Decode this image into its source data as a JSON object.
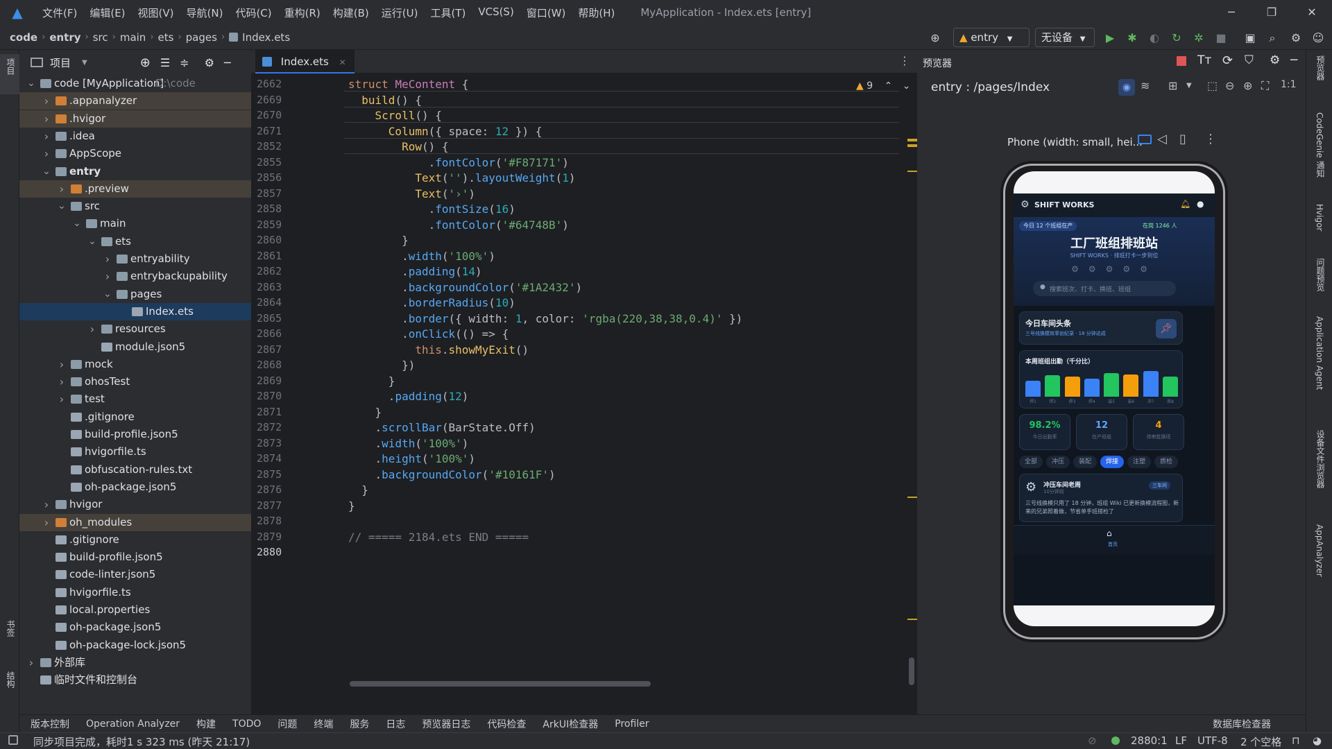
{
  "window": {
    "title": "MyApplication - Index.ets [entry]"
  },
  "menu": [
    "文件(F)",
    "编辑(E)",
    "视图(V)",
    "导航(N)",
    "代码(C)",
    "重构(R)",
    "构建(B)",
    "运行(U)",
    "工具(T)",
    "VCS(S)",
    "窗口(W)",
    "帮助(H)"
  ],
  "breadcrumb": [
    "code",
    "entry",
    "src",
    "main",
    "ets",
    "pages",
    "Index.ets"
  ],
  "run_toolbar": {
    "module": "entry",
    "device": "无设备"
  },
  "left_strip": {
    "project": "项目",
    "bookmarks": "书签",
    "structure": "结构"
  },
  "project_panel": {
    "title": "项目",
    "tree": [
      {
        "depth": 0,
        "arrow": "down",
        "label": "code [MyApplication]",
        "hint": "D:\\code",
        "icon": "module"
      },
      {
        "depth": 1,
        "arrow": "right",
        "label": ".appanalyzer",
        "icon": "folder-orange",
        "hl": true
      },
      {
        "depth": 1,
        "arrow": "right",
        "label": ".hvigor",
        "icon": "folder-orange",
        "hl": true
      },
      {
        "depth": 1,
        "arrow": "right",
        "label": ".idea",
        "icon": "folder"
      },
      {
        "depth": 1,
        "arrow": "right",
        "label": "AppScope",
        "icon": "folder"
      },
      {
        "depth": 1,
        "arrow": "down",
        "label": "entry",
        "icon": "module",
        "bold": true
      },
      {
        "depth": 2,
        "arrow": "right",
        "label": ".preview",
        "icon": "folder-orange",
        "hl": true
      },
      {
        "depth": 2,
        "arrow": "down",
        "label": "src",
        "icon": "folder"
      },
      {
        "depth": 3,
        "arrow": "down",
        "label": "main",
        "icon": "folder"
      },
      {
        "depth": 4,
        "arrow": "down",
        "label": "ets",
        "icon": "folder"
      },
      {
        "depth": 5,
        "arrow": "right",
        "label": "entryability",
        "icon": "folder"
      },
      {
        "depth": 5,
        "arrow": "right",
        "label": "entrybackupability",
        "icon": "folder"
      },
      {
        "depth": 5,
        "arrow": "down",
        "label": "pages",
        "icon": "folder"
      },
      {
        "depth": 6,
        "arrow": "",
        "label": "Index.ets",
        "icon": "file",
        "sel": true
      },
      {
        "depth": 4,
        "arrow": "right",
        "label": "resources",
        "icon": "folder"
      },
      {
        "depth": 4,
        "arrow": "",
        "label": "module.json5",
        "icon": "file"
      },
      {
        "depth": 2,
        "arrow": "right",
        "label": "mock",
        "icon": "folder"
      },
      {
        "depth": 2,
        "arrow": "right",
        "label": "ohosTest",
        "icon": "folder"
      },
      {
        "depth": 2,
        "arrow": "right",
        "label": "test",
        "icon": "folder"
      },
      {
        "depth": 2,
        "arrow": "",
        "label": ".gitignore",
        "icon": "file"
      },
      {
        "depth": 2,
        "arrow": "",
        "label": "build-profile.json5",
        "icon": "file"
      },
      {
        "depth": 2,
        "arrow": "",
        "label": "hvigorfile.ts",
        "icon": "file"
      },
      {
        "depth": 2,
        "arrow": "",
        "label": "obfuscation-rules.txt",
        "icon": "file"
      },
      {
        "depth": 2,
        "arrow": "",
        "label": "oh-package.json5",
        "icon": "file"
      },
      {
        "depth": 1,
        "arrow": "right",
        "label": "hvigor",
        "icon": "folder"
      },
      {
        "depth": 1,
        "arrow": "right",
        "label": "oh_modules",
        "icon": "folder-orange",
        "hl": true
      },
      {
        "depth": 1,
        "arrow": "",
        "label": ".gitignore",
        "icon": "file"
      },
      {
        "depth": 1,
        "arrow": "",
        "label": "build-profile.json5",
        "icon": "file"
      },
      {
        "depth": 1,
        "arrow": "",
        "label": "code-linter.json5",
        "icon": "file"
      },
      {
        "depth": 1,
        "arrow": "",
        "label": "hvigorfile.ts",
        "icon": "file"
      },
      {
        "depth": 1,
        "arrow": "",
        "label": "local.properties",
        "icon": "file"
      },
      {
        "depth": 1,
        "arrow": "",
        "label": "oh-package.json5",
        "icon": "file"
      },
      {
        "depth": 1,
        "arrow": "",
        "label": "oh-package-lock.json5",
        "icon": "file"
      },
      {
        "depth": 0,
        "arrow": "right",
        "label": "外部库",
        "icon": "lib"
      },
      {
        "depth": 0,
        "arrow": "",
        "label": "临时文件和控制台",
        "icon": "scratch"
      }
    ]
  },
  "editor": {
    "tab": "Index.ets",
    "warnings": "9",
    "lines": [
      {
        "n": "2662",
        "sticky": true,
        "html": "<span class='kw'>struct</span> <span class='ty'>MeContent</span> {"
      },
      {
        "n": "2669",
        "sticky": true,
        "html": "  <span class='fn'>build</span>() {"
      },
      {
        "n": "2670",
        "sticky": true,
        "html": "    <span class='fn'>Scroll</span>() {"
      },
      {
        "n": "2671",
        "sticky": true,
        "html": "      <span class='fn'>Column</span>({ space: <span class='num'>12</span> }) {"
      },
      {
        "n": "2852",
        "sticky": true,
        "html": "        <span class='fn'>Row</span>() {"
      },
      {
        "n": "2855",
        "html": "            .<span class='prop'>fontColor</span>(<span class='str'>'#F87171'</span>)",
        "swatch": "#F87171"
      },
      {
        "n": "2856",
        "html": "          <span class='fn'>Text</span>(<span class='str'>''</span>).<span class='prop'>layoutWeight</span>(<span class='num'>1</span>)"
      },
      {
        "n": "2857",
        "html": "          <span class='fn'>Text</span>(<span class='str'>'›'</span>)"
      },
      {
        "n": "2858",
        "html": "            .<span class='prop'>fontSize</span>(<span class='num'>16</span>)"
      },
      {
        "n": "2859",
        "html": "            .<span class='prop'>fontColor</span>(<span class='str'>'#64748B'</span>)",
        "swatch": "#64748B"
      },
      {
        "n": "2860",
        "html": "        }",
        "fold": true
      },
      {
        "n": "2861",
        "html": "        .<span class='prop'>width</span>(<span class='str'>'100%'</span>)"
      },
      {
        "n": "2862",
        "html": "        .<span class='prop'>padding</span>(<span class='num'>14</span>)"
      },
      {
        "n": "2863",
        "html": "        .<span class='prop'>backgroundColor</span>(<span class='str'>'#1A2432'</span>)",
        "swatch": "#1A2432"
      },
      {
        "n": "2864",
        "html": "        .<span class='prop'>borderRadius</span>(<span class='num'>10</span>)"
      },
      {
        "n": "2865",
        "html": "        .<span class='prop'>border</span>({ width: <span class='num'>1</span>, color: <span class='str'>'rgba(220,38,38,0.4)'</span> })",
        "swatch": "#b04a4a"
      },
      {
        "n": "2866",
        "html": "        .<span class='prop'>onClick</span>(() => {",
        "fold": true
      },
      {
        "n": "2867",
        "html": "          <span class='kw'>this</span>.<span class='fn'>showMyExit</span>()"
      },
      {
        "n": "2868",
        "html": "        })",
        "fold": true
      },
      {
        "n": "2869",
        "html": "      }",
        "fold": true
      },
      {
        "n": "2870",
        "html": "      .<span class='prop'>padding</span>(<span class='num'>12</span>)"
      },
      {
        "n": "2871",
        "html": "    }",
        "fold": true
      },
      {
        "n": "2872",
        "html": "    .<span class='prop'>scrollBar</span>(BarState.Off)"
      },
      {
        "n": "2873",
        "html": "    .<span class='prop'>width</span>(<span class='str'>'100%'</span>)"
      },
      {
        "n": "2874",
        "html": "    .<span class='prop'>height</span>(<span class='str'>'100%'</span>)"
      },
      {
        "n": "2875",
        "html": "    .<span class='prop'>backgroundColor</span>(<span class='str'>'#10161F'</span>)",
        "swatch": "#10161F"
      },
      {
        "n": "2876",
        "html": "  }",
        "fold": true
      },
      {
        "n": "2877",
        "html": "}",
        "fold": true
      },
      {
        "n": "2878",
        "html": ""
      },
      {
        "n": "2879",
        "html": "<span class='cm'>// ===== 2184.ets END =====</span>"
      },
      {
        "n": "2880",
        "html": ""
      }
    ]
  },
  "previewer": {
    "title": "预览器",
    "route": "entry : /pages/Index",
    "device_label": "Phone (width: small, hei...",
    "app": {
      "brand": "SHIFT WORKS",
      "badge": "今日 12 个班组在产",
      "online": "在岗 1246 人",
      "headline": "工厂班组排班站",
      "subline": "SHIFT WORKS · 排班打卡一步到位",
      "search_placeholder": "搜索班次、打卡、换班、班组",
      "news_title": "今日车间头条",
      "news_sub": "三号线换模效率创纪录 · 18 分钟达成",
      "chart_title": "本周班组出勤（千分比）",
      "stats": [
        {
          "value": "98.2%",
          "label": "今日出勤率",
          "color": "#22c55e"
        },
        {
          "value": "12",
          "label": "在产班组",
          "color": "#60a5fa"
        },
        {
          "value": "4",
          "label": "待审批换班",
          "color": "#f59e0b"
        }
      ],
      "chips": [
        "全部",
        "冲压",
        "装配",
        "焊接",
        "注塑",
        "质检"
      ],
      "active_chip": "焊接",
      "post_author": "冲压车间老周",
      "post_time": "10分钟前",
      "post_tag": "三车间",
      "post_text": "三号线换模只用了 18 分钟，班组 Wiki 已更新换模流程图，新来的兄弟照着做，节省单手班搭检了",
      "tab_home": "首页"
    }
  },
  "chart_data": {
    "type": "bar",
    "title": "本周班组出勤（千分比）",
    "categories": [
      "焊1",
      "焊2",
      "焊3",
      "焊4",
      "装5",
      "装6",
      "冲7",
      "质8"
    ],
    "values": [
      55,
      75,
      68,
      62,
      80,
      76,
      88,
      70
    ],
    "colors": [
      "#3b82f6",
      "#22c55e",
      "#f59e0b",
      "#3b82f6",
      "#22c55e",
      "#f59e0b",
      "#3b82f6",
      "#22c55e"
    ]
  },
  "right_strip": [
    "预览器",
    "CodeGenie",
    "通知",
    "Hvigor",
    "问题预览",
    "Application Agent",
    "设备文件浏览器",
    "AppAnalyzer"
  ],
  "tool_windows": [
    "版本控制",
    "Operation Analyzer",
    "构建",
    "TODO",
    "问题",
    "终端",
    "服务",
    "日志",
    "预览器日志",
    "代码检查",
    "ArkUI检查器",
    "Profiler",
    "数据库检查器"
  ],
  "status": {
    "message": "同步项目完成，耗时1 s 323 ms (昨天 21:17)",
    "position": "2880:1",
    "line_sep": "LF",
    "encoding": "UTF-8",
    "indent": "2 个空格"
  }
}
